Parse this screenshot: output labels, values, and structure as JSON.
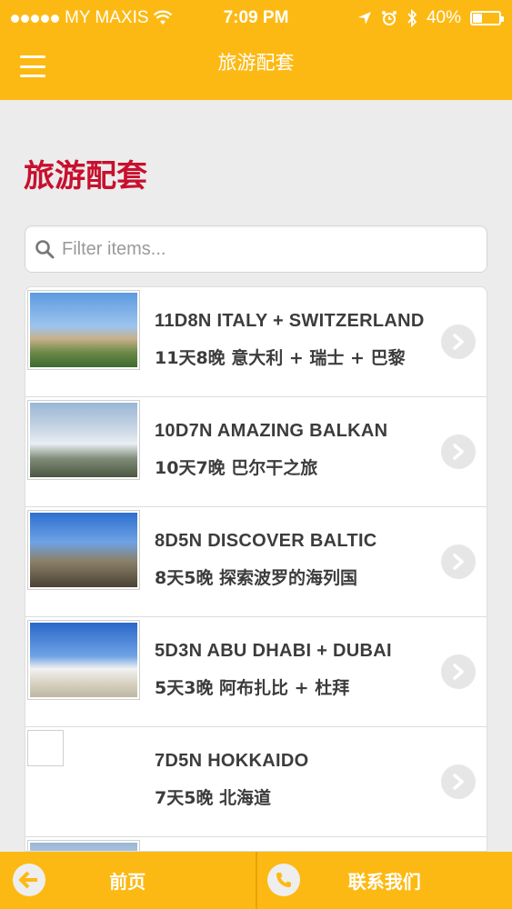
{
  "status_bar": {
    "carrier": "MY MAXIS",
    "time": "7:09 PM",
    "battery_text": "40%",
    "battery_level": 0.4,
    "icons": [
      "signal-dots-icon",
      "wifi-icon",
      "location-arrow-icon",
      "alarm-icon",
      "bluetooth-icon",
      "battery-icon"
    ]
  },
  "nav": {
    "title": "旅游配套",
    "menu_icon": "hamburger-menu-icon"
  },
  "page": {
    "heading": "旅游配套"
  },
  "search": {
    "placeholder": "Filter items...",
    "value": "",
    "icon": "search-icon"
  },
  "packages": [
    {
      "title": "11D8N ITALY + SWITZERLAND",
      "subtitle": "11天8晚 意大利 + 瑞士 + 巴黎",
      "thumb": "italy"
    },
    {
      "title": "10D7N AMAZING BALKAN",
      "subtitle": "10天7晚 巴尔干之旅",
      "thumb": "balkan"
    },
    {
      "title": "8D5N DISCOVER BALTIC",
      "subtitle": "8天5晚 探索波罗的海列国",
      "thumb": "baltic"
    },
    {
      "title": "5D3N ABU DHABI + DUBAI",
      "subtitle": "5天3晚 阿布扎比 + 杜拜",
      "thumb": "abudhabi"
    },
    {
      "title": "7D5N HOKKAIDO",
      "subtitle": "7天5晚 北海道",
      "thumb": "none"
    }
  ],
  "bottom_bar": {
    "back_label": "前页",
    "contact_label": "联系我们",
    "back_icon": "back-arrow-icon",
    "contact_icon": "phone-icon"
  },
  "colors": {
    "brand_yellow": "#fdb913",
    "heading_red": "#c8102e",
    "background": "#ececec"
  }
}
